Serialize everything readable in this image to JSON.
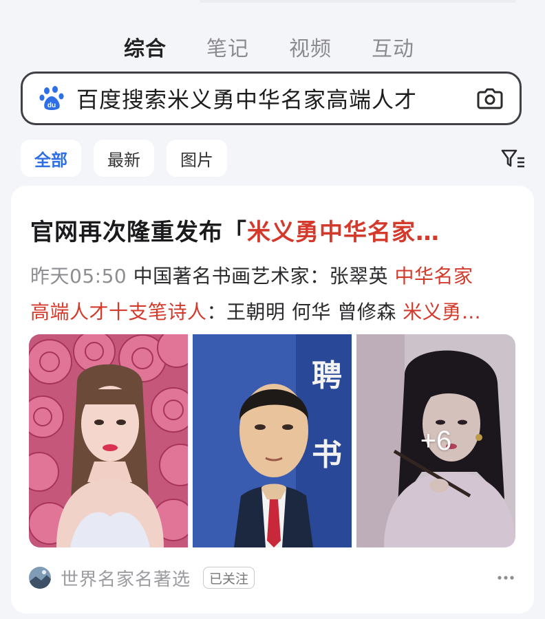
{
  "tabs": [
    {
      "label": "综合",
      "active": true
    },
    {
      "label": "笔记",
      "active": false
    },
    {
      "label": "视频",
      "active": false
    },
    {
      "label": "互动",
      "active": false
    }
  ],
  "search": {
    "query": "百度搜索米义勇中华名家高端人才",
    "left_icon": "baidu-paw-icon",
    "right_icon": "camera-icon"
  },
  "filters": [
    {
      "label": "全部",
      "active": true
    },
    {
      "label": "最新",
      "active": false
    },
    {
      "label": "图片",
      "active": false
    }
  ],
  "filter_icon": "filter-icon",
  "result": {
    "title_prefix": "官网再次隆重发布「",
    "title_highlight": "米义勇中华名家…",
    "time": "昨天05:50",
    "snippet_line1_text": " 中国著名书画艺术家：张翠英 ",
    "snippet_line1_highlight": "中华名家",
    "snippet_line2_highlight": "高端人才十支笔诗人",
    "snippet_line2_text": "：王朝明 何华 曾修森 ",
    "snippet_line2_highlight2": "米义勇…",
    "images": [
      {
        "name": "woman-roses-photo"
      },
      {
        "name": "man-certificate-photo",
        "certificate_text": "聘书"
      },
      {
        "name": "woman-painting-photo",
        "more_count": "+6"
      }
    ],
    "source_name": "世界名家名著选",
    "follow_label": "已关注",
    "more_icon": "more-dots-icon"
  },
  "colors": {
    "accent_blue": "#2f6fe6",
    "highlight_red": "#d33a2c",
    "background": "#f4f5f9"
  }
}
